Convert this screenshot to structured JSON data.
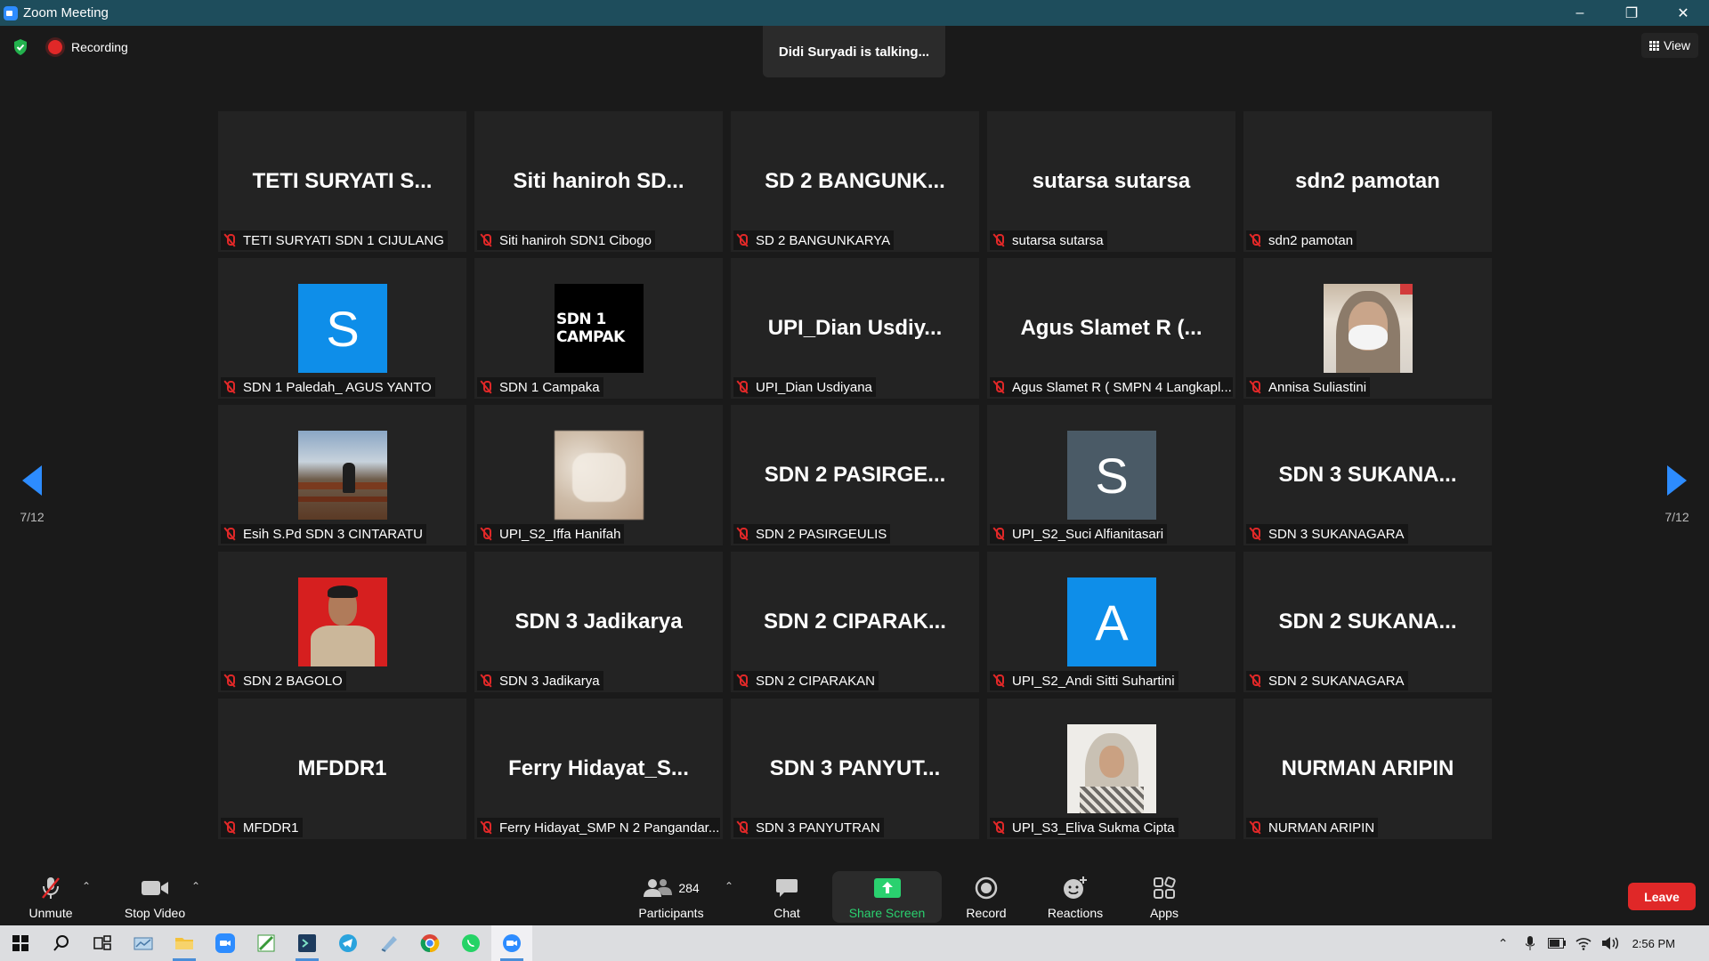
{
  "window": {
    "title": "Zoom Meeting"
  },
  "top": {
    "recording_label": "Recording",
    "talking_text": "Didi Suryadi is talking...",
    "view_label": "View"
  },
  "pagination": {
    "left_page": "7/12",
    "right_page": "7/12"
  },
  "tiles": [
    {
      "big": "TETI SURYATI S...",
      "label": "TETI SURYATI SDN 1 CIJULANG",
      "kind": "text"
    },
    {
      "big": "Siti haniroh SD...",
      "label": "Siti haniroh SDN1 Cibogo",
      "kind": "text"
    },
    {
      "big": "SD 2 BANGUNK...",
      "label": "SD 2 BANGUNKARYA",
      "kind": "text"
    },
    {
      "big": "sutarsa sutarsa",
      "label": "sutarsa sutarsa",
      "kind": "text"
    },
    {
      "big": "sdn2 pamotan",
      "label": "sdn2 pamotan",
      "kind": "text"
    },
    {
      "big": "S",
      "label": "SDN 1 Paledah_ AGUS YANTO",
      "kind": "letter",
      "color": "#0e8ee9"
    },
    {
      "big": "SDN 1 CAMPAK",
      "label": "SDN 1 Campaka",
      "kind": "black"
    },
    {
      "big": "UPI_Dian  Usdiy...",
      "label": "UPI_Dian Usdiyana",
      "kind": "text"
    },
    {
      "big": "Agus Slamet R (...",
      "label": "Agus Slamet R ( SMPN 4 Langkapl...",
      "kind": "text"
    },
    {
      "big": "",
      "label": "Annisa Suliastini",
      "kind": "photo-mask"
    },
    {
      "big": "",
      "label": "Esih S.Pd SDN 3 CINTARATU",
      "kind": "photo-landscape"
    },
    {
      "big": "",
      "label": "UPI_S2_Iffa Hanifah",
      "kind": "photo-blur"
    },
    {
      "big": "SDN 2 PASIRGE...",
      "label": "SDN 2 PASIRGEULIS",
      "kind": "text"
    },
    {
      "big": "S",
      "label": "UPI_S2_Suci Alfianitasari",
      "kind": "letter",
      "color": "#4a5a66"
    },
    {
      "big": "SDN 3 SUKANA...",
      "label": "SDN 3 SUKANAGARA",
      "kind": "text"
    },
    {
      "big": "",
      "label": "SDN 2 BAGOLO",
      "kind": "photo-man"
    },
    {
      "big": "SDN 3 Jadikarya",
      "label": "SDN 3 Jadikarya",
      "kind": "text"
    },
    {
      "big": "SDN 2 CIPARAK...",
      "label": "SDN 2 CIPARAKAN",
      "kind": "text"
    },
    {
      "big": "A",
      "label": "UPI_S2_Andi Sitti Suhartini",
      "kind": "letter",
      "color": "#0e8ee9"
    },
    {
      "big": "SDN 2 SUKANA...",
      "label": "SDN 2 SUKANAGARA",
      "kind": "text"
    },
    {
      "big": "MFDDR1",
      "label": "MFDDR1",
      "kind": "text"
    },
    {
      "big": "Ferry  Hidayat_S...",
      "label": "Ferry Hidayat_SMP N 2 Pangandar...",
      "kind": "text"
    },
    {
      "big": "SDN 3 PANYUT...",
      "label": "SDN 3 PANYUTRAN",
      "kind": "text"
    },
    {
      "big": "",
      "label": "UPI_S3_Eliva Sukma Cipta",
      "kind": "photo-hijab"
    },
    {
      "big": "NURMAN ARIPIN",
      "label": "NURMAN ARIPIN",
      "kind": "text"
    }
  ],
  "toolbar": {
    "unmute": "Unmute",
    "stop_video": "Stop Video",
    "participants": "Participants",
    "participants_count": "284",
    "chat": "Chat",
    "share_screen": "Share Screen",
    "record": "Record",
    "reactions": "Reactions",
    "apps": "Apps",
    "leave": "Leave"
  },
  "taskbar": {
    "clock": "2:56 PM"
  },
  "colors": {
    "accent": "#2d8cff",
    "share_green": "#2ad16f",
    "leave_red": "#e02828",
    "mic_off_red": "#e02828"
  }
}
